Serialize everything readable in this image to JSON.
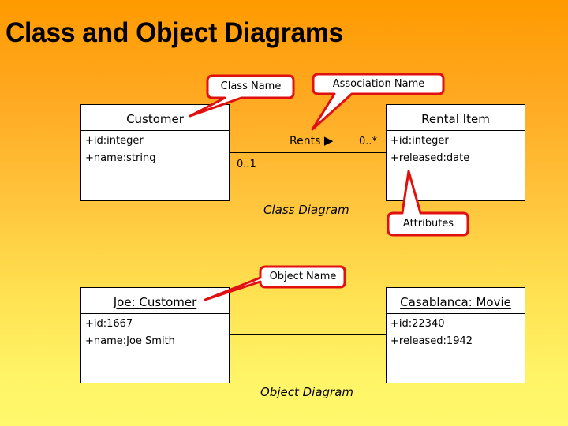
{
  "slide": {
    "title": "Class and Object Diagrams"
  },
  "class_diagram": {
    "caption": "Class Diagram",
    "classes": [
      {
        "name": "Customer",
        "attributes": [
          "+id:integer",
          "+name:string"
        ]
      },
      {
        "name": "Rental Item",
        "attributes": [
          "+id:integer",
          "+released:date"
        ]
      }
    ],
    "association": {
      "name": "Rents",
      "direction_glyph": "▶",
      "multiplicity_left": "0..1",
      "multiplicity_right": "0..*"
    }
  },
  "object_diagram": {
    "caption": "Object Diagram",
    "objects": [
      {
        "name": "Joe: Customer",
        "attributes": [
          "+id:1667",
          "+name:Joe Smith"
        ]
      },
      {
        "name": "Casablanca: Movie",
        "attributes": [
          "+id:22340",
          "+released:1942"
        ]
      }
    ]
  },
  "callouts": {
    "class_name": "Class Name",
    "association_name": "Association Name",
    "attributes": "Attributes",
    "object_name": "Object Name"
  },
  "colors": {
    "callout_border": "#e01010",
    "background_top": "#ff9a00",
    "background_bottom": "#fff86c"
  }
}
